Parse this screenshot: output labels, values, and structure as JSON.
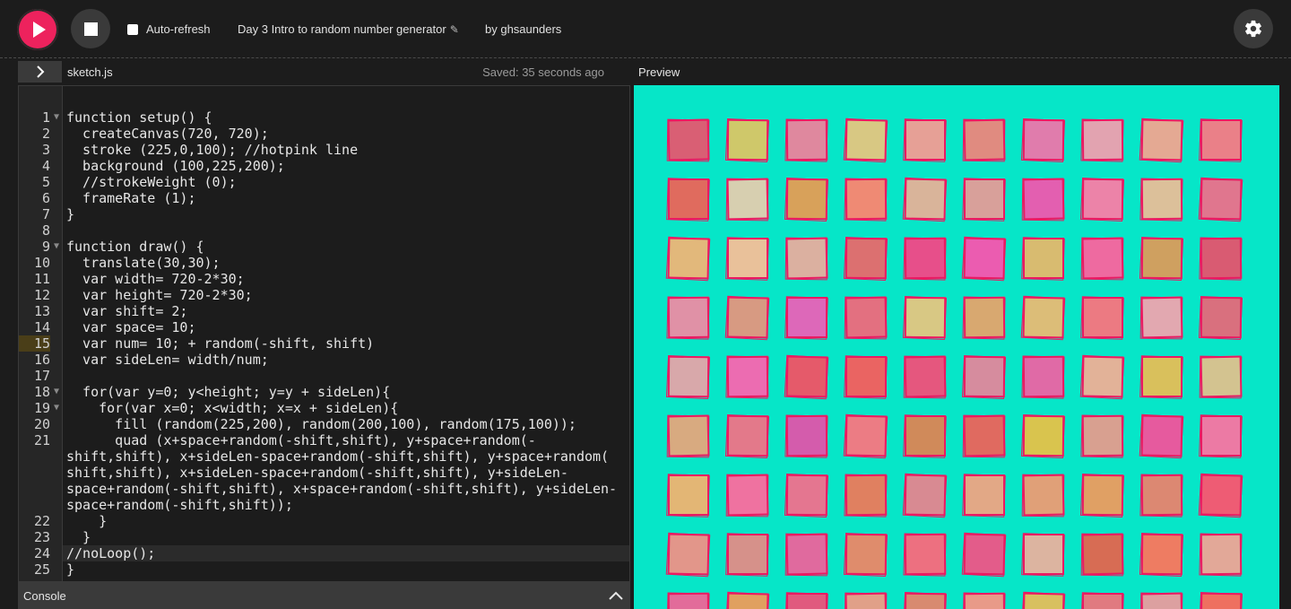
{
  "toolbar": {
    "play_icon": "play-icon",
    "stop_icon": "stop-icon",
    "auto_refresh_label": "Auto-refresh",
    "auto_refresh_checked": false,
    "project_name": "Day 3 Intro to random number generator",
    "author": "by ghsaunders",
    "settings_icon": "gear-icon"
  },
  "editor": {
    "file_name": "sketch.js",
    "saved_status": "Saved: 35 seconds ago",
    "highlighted_line": 15,
    "cursor_line": 24,
    "lines": [
      {
        "n": "1",
        "fold": true,
        "text": "function setup() {"
      },
      {
        "n": "2",
        "text": "  createCanvas(720, 720);"
      },
      {
        "n": "3",
        "text": "  stroke (225,0,100); //hotpink line"
      },
      {
        "n": "4",
        "text": "  background (100,225,200);"
      },
      {
        "n": "5",
        "text": "  //strokeWeight (0);"
      },
      {
        "n": "6",
        "text": "  frameRate (1);"
      },
      {
        "n": "7",
        "text": "}"
      },
      {
        "n": "8",
        "text": ""
      },
      {
        "n": "9",
        "fold": true,
        "text": "function draw() {"
      },
      {
        "n": "10",
        "text": "  translate(30,30);"
      },
      {
        "n": "11",
        "text": "  var width= 720-2*30;"
      },
      {
        "n": "12",
        "text": "  var height= 720-2*30;"
      },
      {
        "n": "13",
        "text": "  var shift= 2;"
      },
      {
        "n": "14",
        "text": "  var space= 10;"
      },
      {
        "n": "15",
        "text": "  var num= 10; + random(-shift, shift)"
      },
      {
        "n": "16",
        "text": "  var sideLen= width/num;"
      },
      {
        "n": "17",
        "text": ""
      },
      {
        "n": "18",
        "fold": true,
        "text": "  for(var y=0; y<height; y=y + sideLen){"
      },
      {
        "n": "19",
        "fold": true,
        "text": "    for(var x=0; x<width; x=x + sideLen){"
      },
      {
        "n": "20",
        "text": "      fill (random(225,200), random(200,100), random(175,100));"
      },
      {
        "n": "21",
        "text": "      quad (x+space+random(-shift,shift), y+space+random(-"
      },
      {
        "n": "",
        "text": "shift,shift), x+sideLen-space+random(-shift,shift), y+space+random("
      },
      {
        "n": "",
        "text": "shift,shift), x+sideLen-space+random(-shift,shift), y+sideLen-"
      },
      {
        "n": "",
        "text": "space+random(-shift,shift), x+space+random(-shift,shift), y+sideLen-"
      },
      {
        "n": "",
        "text": "space+random(-shift,shift));"
      },
      {
        "n": "22",
        "text": "    }"
      },
      {
        "n": "23",
        "text": "  }"
      },
      {
        "n": "24",
        "text": "//noLoop();"
      },
      {
        "n": "25",
        "text": "}"
      }
    ]
  },
  "preview": {
    "label": "Preview",
    "background_color": "#06e6c8",
    "stroke_color": "#ea1a62",
    "colors": [
      [
        "#d95f74",
        "#cfc86a",
        "#df889e",
        "#d8c883",
        "#e6a096",
        "#e08b80",
        "#e07cac",
        "#e2a3b0",
        "#e4a993",
        "#ea8088"
      ],
      [
        "#e06b5e",
        "#d7cfb0",
        "#d8a15a",
        "#ef8a74",
        "#d9b49a",
        "#d8a09a",
        "#e35fb0",
        "#ec83a8",
        "#dcc09a",
        "#e0768e"
      ],
      [
        "#e2b87b",
        "#e9c19a",
        "#dbb0a0",
        "#dc7070",
        "#e74f8a",
        "#eb5cb0",
        "#d8bb70",
        "#ee6aa0",
        "#cfa060",
        "#d95b72"
      ],
      [
        "#e091a6",
        "#d79a82",
        "#dd68b9",
        "#e37080",
        "#d8c884",
        "#d8a870",
        "#dcbd78",
        "#ec7a82",
        "#e2a8b0",
        "#d9707e"
      ],
      [
        "#d8a8aa",
        "#ec6cb1",
        "#e55a6a",
        "#ea6462",
        "#e5577e",
        "#d68c9e",
        "#e06aa6",
        "#e2b298",
        "#d9c05c",
        "#d3c390"
      ],
      [
        "#d8aa80",
        "#e3798a",
        "#d45cac",
        "#ec7c84",
        "#d08a5a",
        "#e06a60",
        "#d9c44e",
        "#d8a090",
        "#e65a9e",
        "#ec7aa4"
      ],
      [
        "#e3b675",
        "#ef72a0",
        "#e47690",
        "#e08060",
        "#d88a92",
        "#e2a886",
        "#e0a078",
        "#e0a064",
        "#dc8872",
        "#ee5c74"
      ],
      [
        "#e2968a",
        "#d6918a",
        "#e06a9e",
        "#df8c6c",
        "#ed7080",
        "#e35c8a",
        "#dcb4a0",
        "#d76c54",
        "#ee7c62",
        "#e2a898"
      ],
      [
        "#e26c9a",
        "#e0a060",
        "#e05a7e",
        "#e0a088",
        "#d88a70",
        "#e89a88",
        "#d8c060",
        "#e07a80",
        "#dca0a0",
        "#ee7060"
      ]
    ]
  }
}
